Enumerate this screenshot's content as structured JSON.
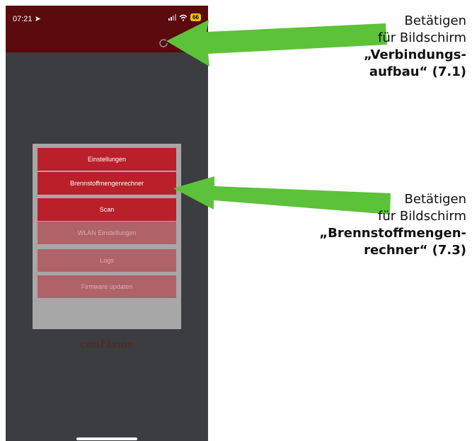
{
  "status_bar": {
    "time": "07:21",
    "battery": "66"
  },
  "menu": {
    "items": [
      {
        "label": "Einstellungen",
        "enabled": true
      },
      {
        "label": "Brennstoffmengenrechner",
        "enabled": true
      },
      {
        "label": "Scan",
        "enabled": true
      },
      {
        "label": "WLAN Einstellungen",
        "enabled": false
      },
      {
        "label": "Logs",
        "enabled": false
      },
      {
        "label": "Firmware updaten",
        "enabled": false
      }
    ]
  },
  "brand": "conFlame",
  "annotations": [
    {
      "line1": "Betätigen",
      "line2": "für Bildschirm",
      "bold1": "„Verbindungs-",
      "bold2": "aufbau“ (7.1)"
    },
    {
      "line1": "Betätigen",
      "line2": "für Bildschirm",
      "bold1": "„Brennstoffmengen-",
      "bold2": "rechner“ (7.3)"
    }
  ],
  "colors": {
    "app_bar": "#5b0a0d",
    "background": "#3b3d40",
    "button_active": "#b9202a",
    "button_disabled": "#b06269",
    "arrow": "#5cc23a"
  },
  "icons": [
    "location-arrow-icon",
    "signal-icon",
    "wifi-icon",
    "refresh-icon"
  ]
}
